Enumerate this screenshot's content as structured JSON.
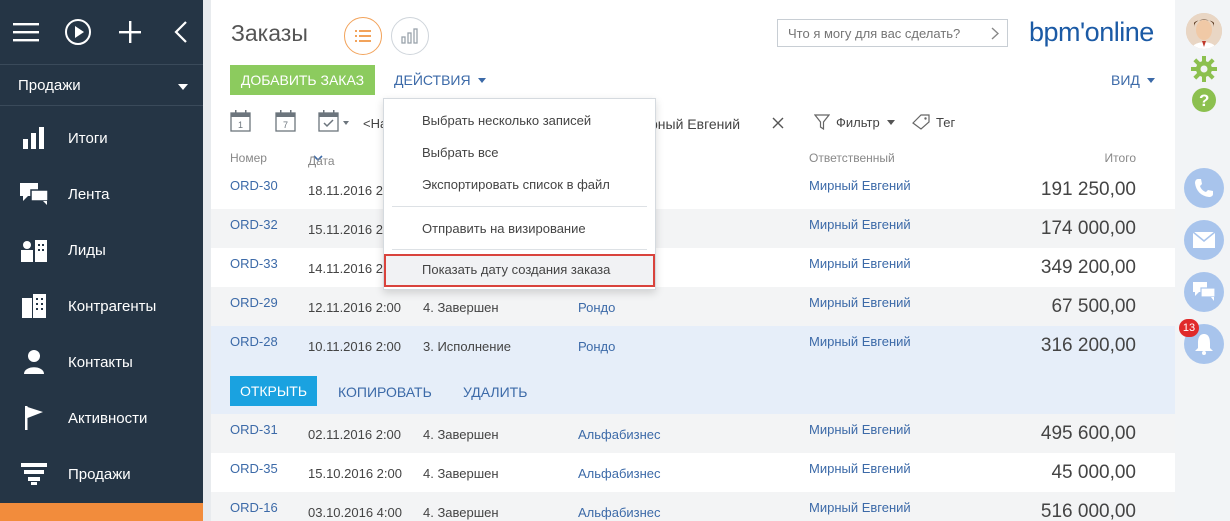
{
  "nav": {
    "section": "Продажи",
    "items": [
      {
        "label": "Итоги",
        "icon": "bar-chart-icon"
      },
      {
        "label": "Лента",
        "icon": "feed-icon"
      },
      {
        "label": "Лиды",
        "icon": "leads-icon"
      },
      {
        "label": "Контрагенты",
        "icon": "building-icon"
      },
      {
        "label": "Контакты",
        "icon": "person-icon"
      },
      {
        "label": "Активности",
        "icon": "flag-icon"
      },
      {
        "label": "Продажи",
        "icon": "funnel-icon"
      }
    ]
  },
  "header": {
    "title": "Заказы",
    "search_placeholder": "Что я могу для вас сделать?",
    "brand": "bpm'online"
  },
  "toolbar": {
    "add_label": "ДОБАВИТЬ ЗАКАЗ",
    "actions_label": "ДЕЙСТВИЯ",
    "view_label": "ВИД"
  },
  "filters": {
    "quick_text": "<На",
    "owner_filter": "рный Евгений",
    "filter_label": "Фильтр",
    "tag_label": "Тег"
  },
  "grid": {
    "columns": {
      "number": "Номер",
      "date": "Дата",
      "owner": "Ответственный",
      "total": "Итого"
    },
    "rows": [
      {
        "number": "ORD-30",
        "date": "18.11.2016 2:",
        "state": "",
        "account": "",
        "owner": "Мирный Евгений",
        "total": "191 250,00"
      },
      {
        "number": "ORD-32",
        "date": "15.11.2016 2:",
        "state": "",
        "account": "",
        "owner": "Мирный Евгений",
        "total": "174 000,00"
      },
      {
        "number": "ORD-33",
        "date": "14.11.2016 2:",
        "state": "",
        "account": "",
        "owner": "Мирный Евгений",
        "total": "349 200,00"
      },
      {
        "number": "ORD-29",
        "date": "12.11.2016 2:00",
        "state": "4. Завершен",
        "account": "Рондо",
        "owner": "Мирный Евгений",
        "total": "67 500,00"
      },
      {
        "number": "ORD-28",
        "date": "10.11.2016 2:00",
        "state": "3. Исполнение",
        "account": "Рондо",
        "owner": "Мирный Евгений",
        "total": "316 200,00"
      },
      {
        "number": "ORD-31",
        "date": "02.11.2016 2:00",
        "state": "4. Завершен",
        "account": "Альфабизнес",
        "owner": "Мирный Евгений",
        "total": "495 600,00"
      },
      {
        "number": "ORD-35",
        "date": "15.10.2016 2:00",
        "state": "4. Завершен",
        "account": "Альфабизнес",
        "owner": "Мирный Евгений",
        "total": "45 000,00"
      },
      {
        "number": "ORD-16",
        "date": "03.10.2016 4:00",
        "state": "4. Завершен",
        "account": "Альфабизнес",
        "owner": "Мирный Евгений",
        "total": "516 000,00"
      }
    ],
    "row_actions": {
      "open": "ОТКРЫТЬ",
      "copy": "КОПИРОВАТЬ",
      "delete": "УДАЛИТЬ"
    }
  },
  "actions_menu": {
    "items": [
      "Выбрать несколько записей",
      "Выбрать все",
      "Экспортировать список в файл",
      "Отправить на визирование",
      "Показать дату создания заказа"
    ]
  },
  "right_panel": {
    "notification_count": "13"
  },
  "colors": {
    "nav_bg": "#253545",
    "add_button": "#8ccb5e",
    "open_button": "#1aa2e0",
    "link": "#3c6aa8",
    "highlight_border": "#d9433c",
    "accent_orange": "#f28c3c"
  }
}
